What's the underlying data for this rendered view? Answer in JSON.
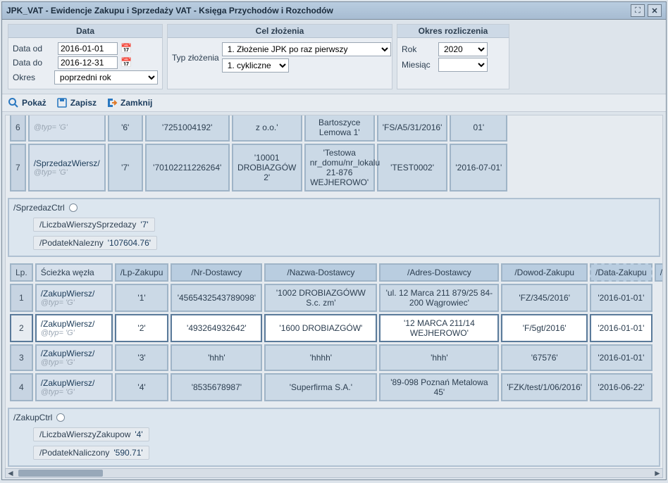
{
  "window": {
    "title": "JPK_VAT - Ewidencje Zakupu i Sprzedaży VAT - Księga Przychodów i Rozchodów"
  },
  "filters": {
    "data": {
      "header": "Data",
      "from_label": "Data od",
      "from_value": "2016-01-01",
      "to_label": "Data do",
      "to_value": "2016-12-31",
      "okres_label": "Okres",
      "okres_value": "poprzedni rok"
    },
    "cel": {
      "header": "Cel złożenia",
      "typ_label": "Typ złożenia",
      "typ1": "1. Złożenie JPK po raz pierwszy",
      "typ2": "1. cykliczne"
    },
    "okres_roz": {
      "header": "Okres rozliczenia",
      "rok_label": "Rok",
      "rok_value": "2020",
      "mies_label": "Miesiąc",
      "mies_value": ""
    }
  },
  "toolbar": {
    "pokaz": "Pokaż",
    "zapisz": "Zapisz",
    "zamknij": "Zamknij"
  },
  "sprzedaz_cut": {
    "row6": {
      "idx": "6",
      "lp": "'6'",
      "nr": "'7251004192'",
      "nazwa": "z o.o.'",
      "adres": "Bartoszyce Lemowa 1'",
      "dowod": "'FS/A5/31/2016'",
      "data": "01'"
    },
    "row7": {
      "idx": "7",
      "path_main": "/SprzedazWiersz/",
      "path_sub": "@typ= 'G'",
      "lp": "'7'",
      "nr": "'70102211226264'",
      "nazwa": "'10001 DROBIAZGÓW 2'",
      "adres": "'Testowa nr_domu/nr_lokalu 21-876 WEJHEROWO'",
      "dowod": "'TEST0002'",
      "data": "'2016-07-01'"
    }
  },
  "sprzedaz_ctrl": {
    "header": "/SprzedazCtrl",
    "liczba_label": "/LiczbaWierszySprzedazy",
    "liczba_val": "'7'",
    "podatek_label": "/PodatekNalezny",
    "podatek_val": "'107604.76'"
  },
  "zakup_headers": {
    "lp": "Lp.",
    "sciezka": "Ścieżka węzła",
    "lpzak": "/Lp-Zakupu",
    "nrdost": "/Nr-Dostawcy",
    "nazwa": "/Nazwa-Dostawcy",
    "adres": "/Adres-Dostawcy",
    "dowod": "/Dowod-Zakupu",
    "datazak": "/Data-Zakupu",
    "datawply": "/Data-Wply"
  },
  "zakup_rows": [
    {
      "idx": "1",
      "path_main": "/ZakupWiersz/",
      "path_sub": "@typ= 'G'",
      "lp": "'1'",
      "nr": "'4565432543789098'",
      "nazwa": "'1002 DROBIAZGÓWW S.c. zm'",
      "adres": "'ul. 12 Marca 211 879/25 84-200 Wągrowiec'",
      "dowod": "'FZ/345/2016'",
      "data": "'2016-01-01'",
      "selected": false
    },
    {
      "idx": "2",
      "path_main": "/ZakupWiersz/",
      "path_sub": "@typ= 'G'",
      "lp": "'2'",
      "nr": "'493264932642'",
      "nazwa": "'1600 DROBIAZGÓW'",
      "adres": "'12 MARCA 211/14 WEJHEROWO'",
      "dowod": "'F/5gt/2016'",
      "data": "'2016-01-01'",
      "selected": true
    },
    {
      "idx": "3",
      "path_main": "/ZakupWiersz/",
      "path_sub": "@typ= 'G'",
      "lp": "'3'",
      "nr": "'hhh'",
      "nazwa": "'hhhh'",
      "adres": "'hhh'",
      "dowod": "'67576'",
      "data": "'2016-01-01'",
      "selected": false
    },
    {
      "idx": "4",
      "path_main": "/ZakupWiersz/",
      "path_sub": "@typ= 'G'",
      "lp": "'4'",
      "nr": "'8535678987'",
      "nazwa": "'Superfirma S.A.'",
      "adres": "'89-098 Poznań Metalowa 45'",
      "dowod": "'FZK/test/1/06/2016'",
      "data": "'2016-06-22'",
      "selected": false
    }
  ],
  "zakup_ctrl": {
    "header": "/ZakupCtrl",
    "liczba_label": "/LiczbaWierszyZakupow",
    "liczba_val": "'4'",
    "podatek_label": "/PodatekNaliczony",
    "podatek_val": "'590.71'"
  }
}
